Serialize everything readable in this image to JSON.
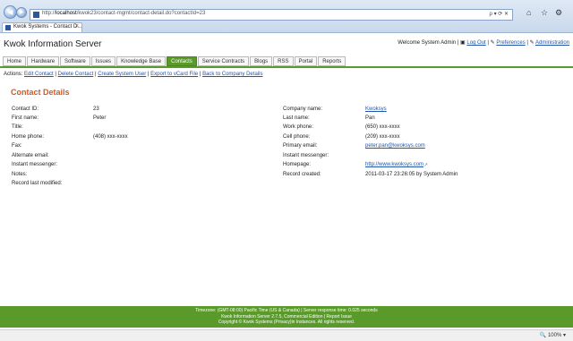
{
  "browser": {
    "url_prefix": "http://",
    "url_host": "localhost",
    "url_path": "/kwok23/contact-mgmt/contact-detail.do?contactId=23",
    "tab_title": "Kwok Systems - Contact D...",
    "tools": "ρ ▾ ⟳ ✕",
    "zoom": "100%"
  },
  "header": {
    "title": "Kwok Information Server",
    "welcome": "Welcome System Admin |",
    "logout": "Log Out",
    "preferences": "Preferences",
    "administration": "Administration"
  },
  "menu": {
    "items": [
      {
        "label": "Home"
      },
      {
        "label": "Hardware"
      },
      {
        "label": "Software"
      },
      {
        "label": "Issues"
      },
      {
        "label": "Knowledge Base"
      },
      {
        "label": "Contacts"
      },
      {
        "label": "Service Contracts"
      },
      {
        "label": "Blogs"
      },
      {
        "label": "RSS"
      },
      {
        "label": "Portal"
      },
      {
        "label": "Reports"
      }
    ]
  },
  "actions": {
    "label": "Actions:",
    "links": [
      "Edit Contact",
      "Delete Contact",
      "Create System User",
      "Export to vCard File",
      "Back to Company Details"
    ]
  },
  "page": {
    "title": "Contact Details"
  },
  "left": {
    "labels": [
      "Contact ID:",
      "First name:",
      "Title:",
      "Home phone:",
      "Fax:",
      "Alternate email:",
      "Instant messenger:",
      "Notes:",
      "Record last modified:"
    ],
    "values": [
      "23",
      "Peter",
      "",
      "(408) xxx-xxxx",
      "",
      "",
      "",
      "",
      ""
    ]
  },
  "right": {
    "labels": [
      "Company name:",
      "Last name:",
      "Work phone:",
      "Cell phone:",
      "Primary email:",
      "Instant messenger:",
      "Homepage:",
      "Record created:"
    ],
    "values": [
      "Kwoksys",
      "Pan",
      "(650) xxx-xxxx",
      "(209) xxx-xxxx",
      "peter.pan@kwoksys.com",
      "",
      "http://www.kwoksys.com",
      "2011-03-17 23:26:05 by System Admin"
    ]
  },
  "footer": {
    "line1": "Timezone: (GMT-08:00) Pacific Time (US & Canada) | Server response time: 0.025 seconds",
    "line2": "Kwok Information Server 2.7.5, Commercial Edition | Report Issue",
    "line3": "Copyright © Kwok Systems (Privacy)in Instances. All rights reserved."
  }
}
